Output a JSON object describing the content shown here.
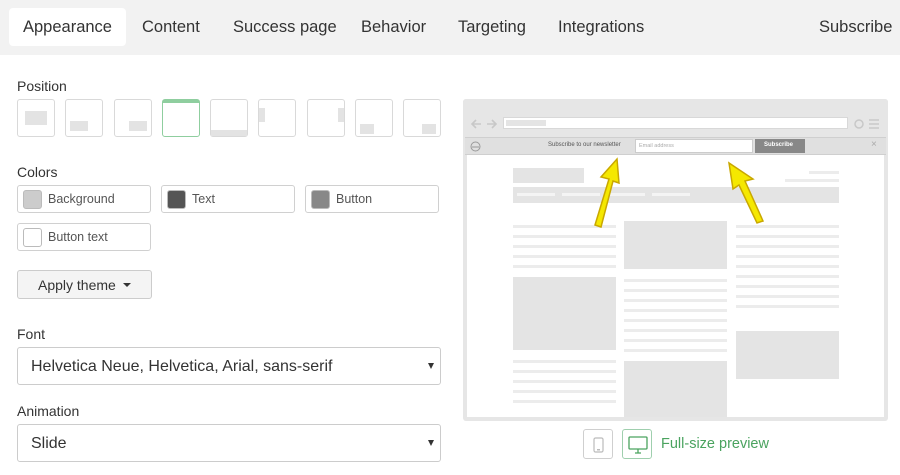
{
  "nav": {
    "tabs": [
      "Appearance",
      "Content",
      "Success page",
      "Behavior",
      "Targeting",
      "Integrations"
    ],
    "right": "Subscribe"
  },
  "position": {
    "label": "Position"
  },
  "colors": {
    "label": "Colors",
    "items": [
      {
        "label": "Background",
        "color": "#cccccc"
      },
      {
        "label": "Text",
        "color": "#555555"
      },
      {
        "label": "Button",
        "color": "#888888"
      },
      {
        "label": "Button text",
        "color": "#ffffff"
      }
    ]
  },
  "apply_theme": "Apply theme",
  "font": {
    "label": "Font",
    "value": "Helvetica Neue, Helvetica, Arial, sans-serif"
  },
  "animation": {
    "label": "Animation",
    "value": "Slide"
  },
  "preview": {
    "banner_text": "Subscribe to our newsletter",
    "email_placeholder": "Email address",
    "subscribe_label": "Subscribe",
    "full_size_label": "Full-size preview"
  },
  "accent_color": "#8fce9f"
}
